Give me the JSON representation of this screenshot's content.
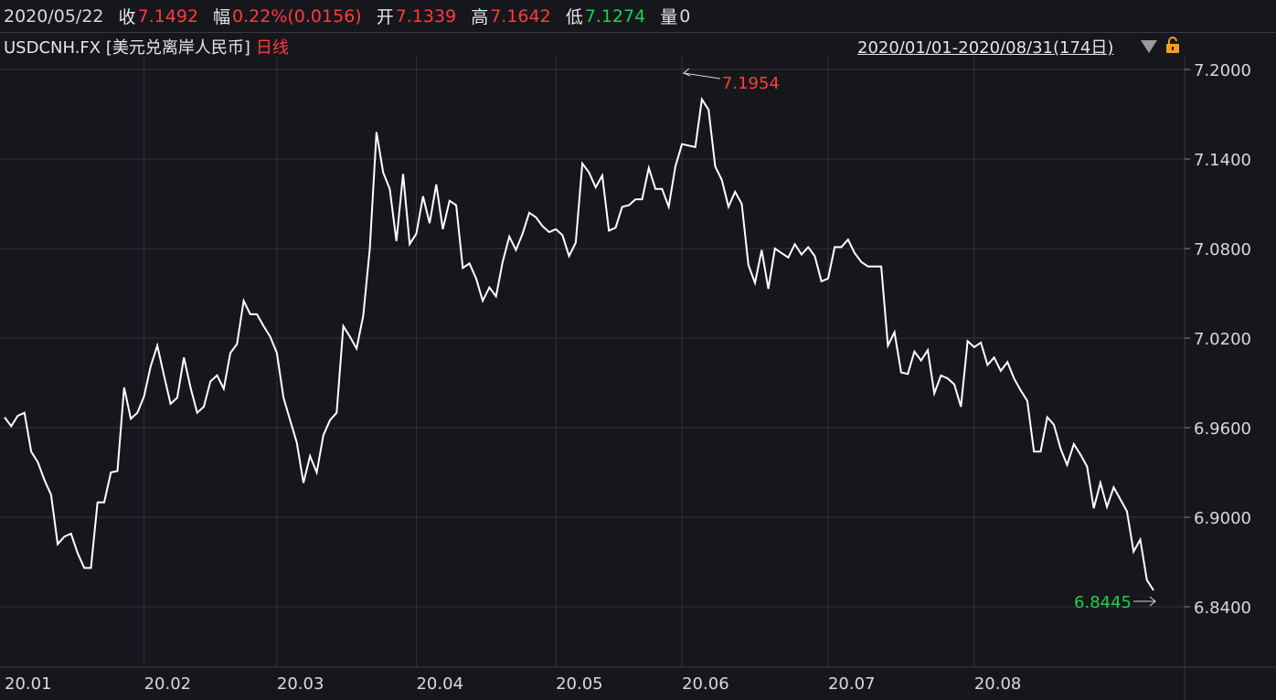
{
  "header": {
    "date": "2020/05/22",
    "close_label": "收",
    "close_value": "7.1492",
    "change_label": "幅",
    "change_value": "0.22%(0.0156)",
    "open_label": "开",
    "open_value": "7.1339",
    "high_label": "高",
    "high_value": "7.1642",
    "low_label": "低",
    "low_value": "7.1274",
    "volume_label": "量",
    "volume_value": "0"
  },
  "title": {
    "symbol": "USDCNH.FX [美元兑离岸人民币]",
    "period": "日线",
    "range": "2020/01/01-2020/08/31(174日)"
  },
  "colors": {
    "up": "#ff3b3b",
    "down": "#1fcf4f",
    "line": "#ffffff",
    "grid": "#3a3b42",
    "background": "#16171c"
  },
  "icons": {
    "dropdown": "triangle-down-icon",
    "lock": "lock-icon"
  },
  "chart_data": {
    "type": "line",
    "series": [
      {
        "values": [
          6.967,
          6.961,
          6.968,
          6.97,
          6.944,
          6.937,
          6.925,
          6.915,
          6.882,
          6.887,
          6.889,
          6.876,
          6.866,
          6.866,
          6.91,
          6.91,
          6.93,
          6.931,
          6.987,
          6.966,
          6.97,
          6.981,
          7.001,
          7.015,
          6.995,
          6.976,
          6.98,
          7.007,
          6.987,
          6.97,
          6.974,
          6.991,
          6.995,
          6.986,
          7.01,
          7.016,
          7.045,
          7.036,
          7.036,
          7.028,
          7.021,
          7.01,
          6.98,
          6.965,
          6.95,
          6.923,
          6.941,
          6.93,
          6.955,
          6.965,
          6.97,
          7.028,
          7.021,
          7.013,
          7.035,
          7.08,
          7.158,
          7.131,
          7.12,
          7.085,
          7.13,
          7.083,
          7.09,
          7.115,
          7.097,
          7.123,
          7.093,
          7.112,
          7.109,
          7.067,
          7.07,
          7.06,
          7.045,
          7.054,
          7.048,
          7.071,
          7.088,
          7.079,
          7.09,
          7.104,
          7.101,
          7.095,
          7.091,
          7.093,
          7.089,
          7.075,
          7.084,
          7.137,
          7.131,
          7.121,
          7.129,
          7.092,
          7.094,
          7.108,
          7.109,
          7.113,
          7.113,
          7.134,
          7.12,
          7.12,
          7.108,
          7.135,
          7.15,
          7.149,
          7.148,
          7.18,
          7.173,
          7.135,
          7.126,
          7.108,
          7.118,
          7.11,
          7.069,
          7.057,
          7.079,
          7.053,
          7.08,
          7.077,
          7.074,
          7.083,
          7.076,
          7.081,
          7.075,
          7.058,
          7.06,
          7.081,
          7.081,
          7.086,
          7.077,
          7.071,
          7.068,
          7.068,
          7.068,
          7.015,
          7.024,
          6.997,
          6.996,
          7.011,
          7.005,
          7.012,
          6.983,
          6.995,
          6.993,
          6.989,
          6.974,
          7.018,
          7.014,
          7.017,
          7.002,
          7.007,
          6.998,
          7.004,
          6.993,
          6.985,
          6.978,
          6.944,
          6.944,
          6.967,
          6.962,
          6.946,
          6.935,
          6.949,
          6.942,
          6.934,
          6.906,
          6.923,
          6.907,
          6.92,
          6.912,
          6.904,
          6.877,
          6.885,
          6.858,
          6.851
        ]
      }
    ],
    "ylim": [
      6.8,
      7.22
    ],
    "yticks": [
      "7.2000",
      "7.1400",
      "7.0800",
      "7.0200",
      "6.9600",
      "6.9000",
      "6.8400"
    ],
    "ytick_values": [
      7.2,
      7.14,
      7.08,
      7.02,
      6.96,
      6.9,
      6.84
    ],
    "xticks": [
      {
        "label": "20.01",
        "index": 0
      },
      {
        "label": "20.02",
        "index": 21
      },
      {
        "label": "20.03",
        "index": 41
      },
      {
        "label": "20.04",
        "index": 62
      },
      {
        "label": "20.05",
        "index": 83
      },
      {
        "label": "20.06",
        "index": 102
      },
      {
        "label": "20.07",
        "index": 124
      },
      {
        "label": "20.08",
        "index": 146
      }
    ],
    "max_annotation": {
      "label": "7.1954",
      "index": 105
    },
    "min_annotation": {
      "label": "6.8445",
      "index": 173
    },
    "grid": true
  }
}
